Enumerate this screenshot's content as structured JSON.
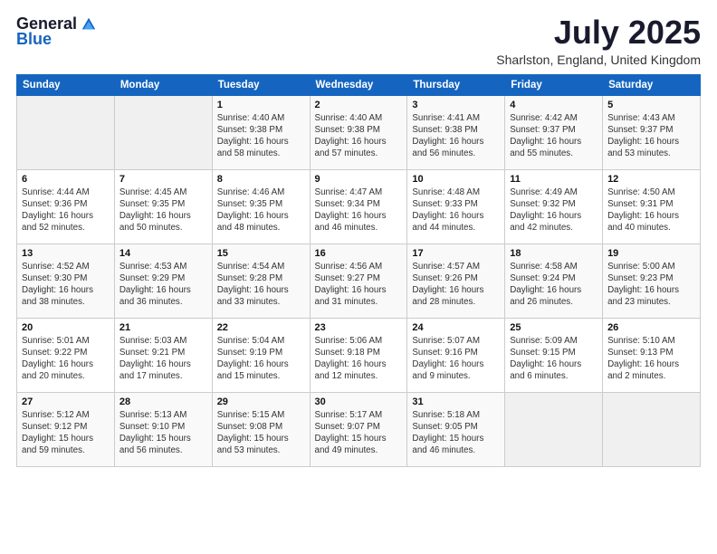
{
  "logo": {
    "general": "General",
    "blue": "Blue"
  },
  "title": "July 2025",
  "location": "Sharlston, England, United Kingdom",
  "days_of_week": [
    "Sunday",
    "Monday",
    "Tuesday",
    "Wednesday",
    "Thursday",
    "Friday",
    "Saturday"
  ],
  "weeks": [
    [
      {
        "day": "",
        "detail": ""
      },
      {
        "day": "",
        "detail": ""
      },
      {
        "day": "1",
        "detail": "Sunrise: 4:40 AM\nSunset: 9:38 PM\nDaylight: 16 hours and 58 minutes."
      },
      {
        "day": "2",
        "detail": "Sunrise: 4:40 AM\nSunset: 9:38 PM\nDaylight: 16 hours and 57 minutes."
      },
      {
        "day": "3",
        "detail": "Sunrise: 4:41 AM\nSunset: 9:38 PM\nDaylight: 16 hours and 56 minutes."
      },
      {
        "day": "4",
        "detail": "Sunrise: 4:42 AM\nSunset: 9:37 PM\nDaylight: 16 hours and 55 minutes."
      },
      {
        "day": "5",
        "detail": "Sunrise: 4:43 AM\nSunset: 9:37 PM\nDaylight: 16 hours and 53 minutes."
      }
    ],
    [
      {
        "day": "6",
        "detail": "Sunrise: 4:44 AM\nSunset: 9:36 PM\nDaylight: 16 hours and 52 minutes."
      },
      {
        "day": "7",
        "detail": "Sunrise: 4:45 AM\nSunset: 9:35 PM\nDaylight: 16 hours and 50 minutes."
      },
      {
        "day": "8",
        "detail": "Sunrise: 4:46 AM\nSunset: 9:35 PM\nDaylight: 16 hours and 48 minutes."
      },
      {
        "day": "9",
        "detail": "Sunrise: 4:47 AM\nSunset: 9:34 PM\nDaylight: 16 hours and 46 minutes."
      },
      {
        "day": "10",
        "detail": "Sunrise: 4:48 AM\nSunset: 9:33 PM\nDaylight: 16 hours and 44 minutes."
      },
      {
        "day": "11",
        "detail": "Sunrise: 4:49 AM\nSunset: 9:32 PM\nDaylight: 16 hours and 42 minutes."
      },
      {
        "day": "12",
        "detail": "Sunrise: 4:50 AM\nSunset: 9:31 PM\nDaylight: 16 hours and 40 minutes."
      }
    ],
    [
      {
        "day": "13",
        "detail": "Sunrise: 4:52 AM\nSunset: 9:30 PM\nDaylight: 16 hours and 38 minutes."
      },
      {
        "day": "14",
        "detail": "Sunrise: 4:53 AM\nSunset: 9:29 PM\nDaylight: 16 hours and 36 minutes."
      },
      {
        "day": "15",
        "detail": "Sunrise: 4:54 AM\nSunset: 9:28 PM\nDaylight: 16 hours and 33 minutes."
      },
      {
        "day": "16",
        "detail": "Sunrise: 4:56 AM\nSunset: 9:27 PM\nDaylight: 16 hours and 31 minutes."
      },
      {
        "day": "17",
        "detail": "Sunrise: 4:57 AM\nSunset: 9:26 PM\nDaylight: 16 hours and 28 minutes."
      },
      {
        "day": "18",
        "detail": "Sunrise: 4:58 AM\nSunset: 9:24 PM\nDaylight: 16 hours and 26 minutes."
      },
      {
        "day": "19",
        "detail": "Sunrise: 5:00 AM\nSunset: 9:23 PM\nDaylight: 16 hours and 23 minutes."
      }
    ],
    [
      {
        "day": "20",
        "detail": "Sunrise: 5:01 AM\nSunset: 9:22 PM\nDaylight: 16 hours and 20 minutes."
      },
      {
        "day": "21",
        "detail": "Sunrise: 5:03 AM\nSunset: 9:21 PM\nDaylight: 16 hours and 17 minutes."
      },
      {
        "day": "22",
        "detail": "Sunrise: 5:04 AM\nSunset: 9:19 PM\nDaylight: 16 hours and 15 minutes."
      },
      {
        "day": "23",
        "detail": "Sunrise: 5:06 AM\nSunset: 9:18 PM\nDaylight: 16 hours and 12 minutes."
      },
      {
        "day": "24",
        "detail": "Sunrise: 5:07 AM\nSunset: 9:16 PM\nDaylight: 16 hours and 9 minutes."
      },
      {
        "day": "25",
        "detail": "Sunrise: 5:09 AM\nSunset: 9:15 PM\nDaylight: 16 hours and 6 minutes."
      },
      {
        "day": "26",
        "detail": "Sunrise: 5:10 AM\nSunset: 9:13 PM\nDaylight: 16 hours and 2 minutes."
      }
    ],
    [
      {
        "day": "27",
        "detail": "Sunrise: 5:12 AM\nSunset: 9:12 PM\nDaylight: 15 hours and 59 minutes."
      },
      {
        "day": "28",
        "detail": "Sunrise: 5:13 AM\nSunset: 9:10 PM\nDaylight: 15 hours and 56 minutes."
      },
      {
        "day": "29",
        "detail": "Sunrise: 5:15 AM\nSunset: 9:08 PM\nDaylight: 15 hours and 53 minutes."
      },
      {
        "day": "30",
        "detail": "Sunrise: 5:17 AM\nSunset: 9:07 PM\nDaylight: 15 hours and 49 minutes."
      },
      {
        "day": "31",
        "detail": "Sunrise: 5:18 AM\nSunset: 9:05 PM\nDaylight: 15 hours and 46 minutes."
      },
      {
        "day": "",
        "detail": ""
      },
      {
        "day": "",
        "detail": ""
      }
    ]
  ]
}
